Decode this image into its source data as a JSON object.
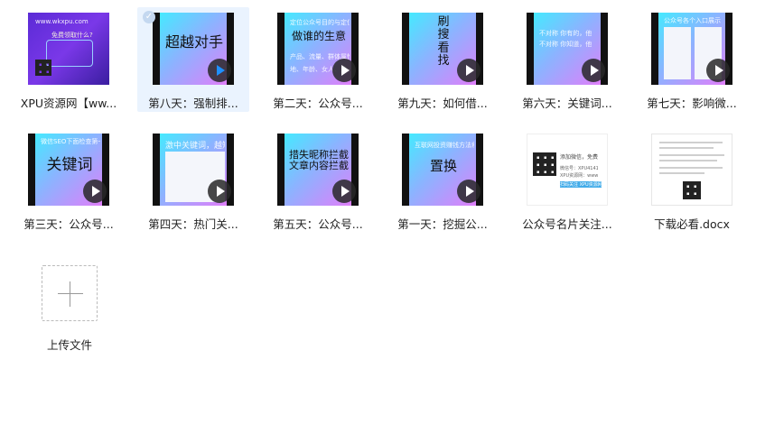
{
  "files": [
    {
      "label": "XPU资源网【ww...",
      "kind": "promo",
      "text_main": "",
      "text_small": [
        "www.wkxpu.com",
        "免费领取什么?"
      ]
    },
    {
      "label": "第八天：强制排...",
      "kind": "video",
      "selected": true,
      "text_main": "超越对手"
    },
    {
      "label": "第二天：公众号...",
      "kind": "video",
      "text_main": "做谁的生意",
      "text_small": [
        "定位公众号目的与定位",
        "产品、流量、群体属性、地",
        "地、年龄、女人、男人"
      ]
    },
    {
      "label": "第九天：如何借...",
      "kind": "video",
      "text_main": "刷\n搜\n看\n找"
    },
    {
      "label": "第六天：关键词...",
      "kind": "video",
      "text_main": "",
      "text_small": [
        "不对称    你有的，他",
        "不对称    你知道，他"
      ]
    },
    {
      "label": "第七天：影响微...",
      "kind": "video",
      "text_main": "",
      "text_small": [
        "公众号各个入口展示"
      ]
    },
    {
      "label": "第三天：公众号...",
      "kind": "video",
      "text_main": "关键词",
      "text_small": [
        "微信SEO下面检查第一点"
      ]
    },
    {
      "label": "第四天：热门关...",
      "kind": "video",
      "text_main": "",
      "text_small": [
        "激中关键词，越短越"
      ]
    },
    {
      "label": "第五天：公众号...",
      "kind": "video",
      "text_main": "措失昵称拦截\n文章内容拦截"
    },
    {
      "label": "第一天：挖掘公...",
      "kind": "video",
      "text_main": "置换",
      "text_small": [
        "互联网投资赚钱方法和逻辑"
      ]
    },
    {
      "label": "公众号名片关注...",
      "kind": "card",
      "text_main": "",
      "text_small": [
        "添加微信，免费领取vi",
        "微信号：XPU4141",
        "XPU资源网：www.wkxpu",
        "扫码关注 XPU资源网"
      ]
    },
    {
      "label": "下载必看.docx",
      "kind": "doc",
      "text_main": ""
    }
  ],
  "upload": {
    "label": "上传文件"
  },
  "icons": {
    "play": "play-icon",
    "check": "check-icon",
    "plus": "plus-icon"
  }
}
